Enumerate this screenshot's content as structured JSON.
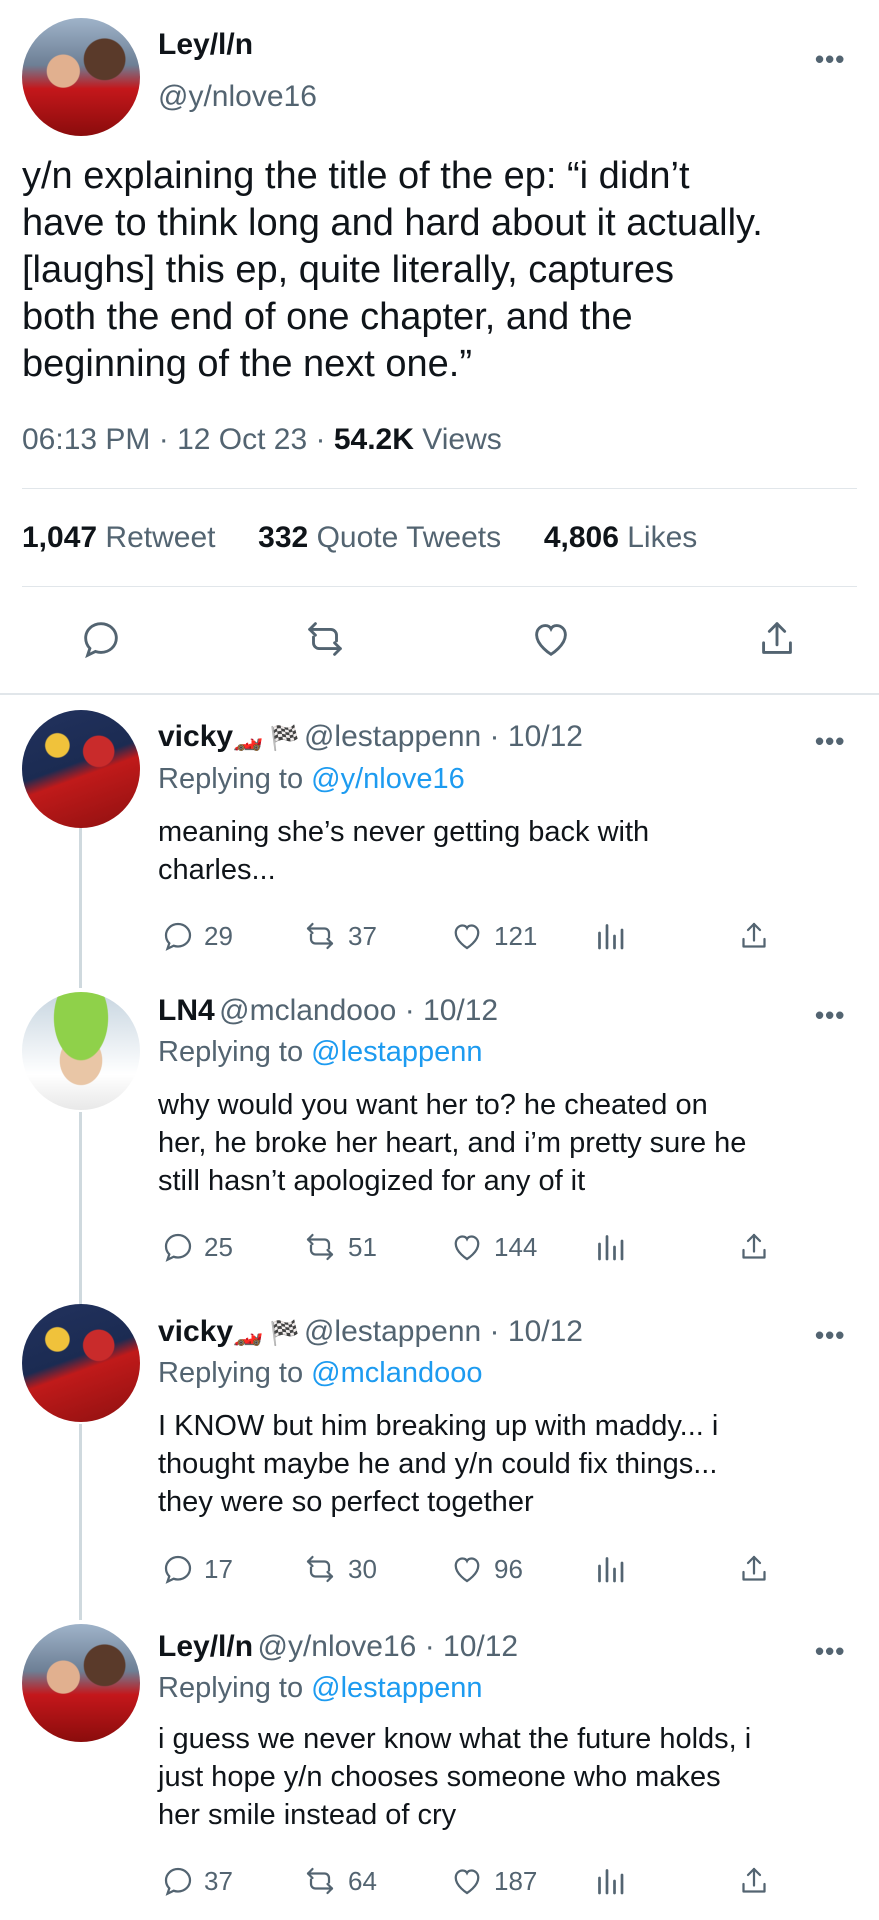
{
  "main_tweet": {
    "display_name": "Ley/l/n",
    "handle": "@y/nlove16",
    "text_lines": [
      "y/n explaining the title of the ep: “i didn’t",
      "have to think long and hard about it actually.",
      "[laughs] this ep, quite literally, captures",
      "both the end of one chapter, and the",
      "beginning of the next one.”"
    ],
    "time": "06:13 PM",
    "date": "12 Oct 23",
    "views_count": "54.2K",
    "views_label": "Views",
    "retweets_count": "1,047",
    "retweets_label": "Retweet",
    "quotes_count": "332",
    "quotes_label": "Quote Tweets",
    "likes_count": "4,806",
    "likes_label": "Likes",
    "more": "•••"
  },
  "replies": [
    {
      "display_name": "vicky",
      "emoji": "🏎️ 🏁",
      "handle": "@lestappenn",
      "date": "10/12",
      "replying_prefix": "Replying to",
      "replying_to": "@y/nlove16",
      "text_lines": [
        "meaning she’s never getting back with",
        "charles..."
      ],
      "replies": "29",
      "retweets": "37",
      "likes": "121"
    },
    {
      "display_name": "LN4",
      "emoji": "",
      "handle": "@mclandooo",
      "date": "10/12",
      "replying_prefix": "Replying to",
      "replying_to": "@lestappenn",
      "text_lines": [
        "why would you want her to? he cheated on",
        "her, he broke her heart, and i’m pretty sure he",
        "still hasn’t apologized for any of it"
      ],
      "replies": "25",
      "retweets": "51",
      "likes": "144"
    },
    {
      "display_name": "vicky",
      "emoji": "🏎️ 🏁",
      "handle": "@lestappenn",
      "date": "10/12",
      "replying_prefix": "Replying to",
      "replying_to": "@mclandooo",
      "text_lines": [
        "I KNOW but him breaking up with maddy... i",
        "thought maybe he and y/n could fix things...",
        "they were so perfect together"
      ],
      "replies": "17",
      "retweets": "30",
      "likes": "96"
    },
    {
      "display_name": "Ley/l/n",
      "emoji": "",
      "handle": "@y/nlove16",
      "date": "10/12",
      "replying_prefix": "Replying to",
      "replying_to": "@lestappenn",
      "text_lines": [
        "i guess we never know what the future holds, i",
        "just hope y/n chooses someone who makes",
        "her smile instead of cry"
      ],
      "replies": "37",
      "retweets": "64",
      "likes": "187"
    }
  ],
  "colors": {
    "link": "#1d9bf0",
    "muted": "#536471",
    "text": "#0f1419",
    "divider": "#e1e6ea"
  }
}
